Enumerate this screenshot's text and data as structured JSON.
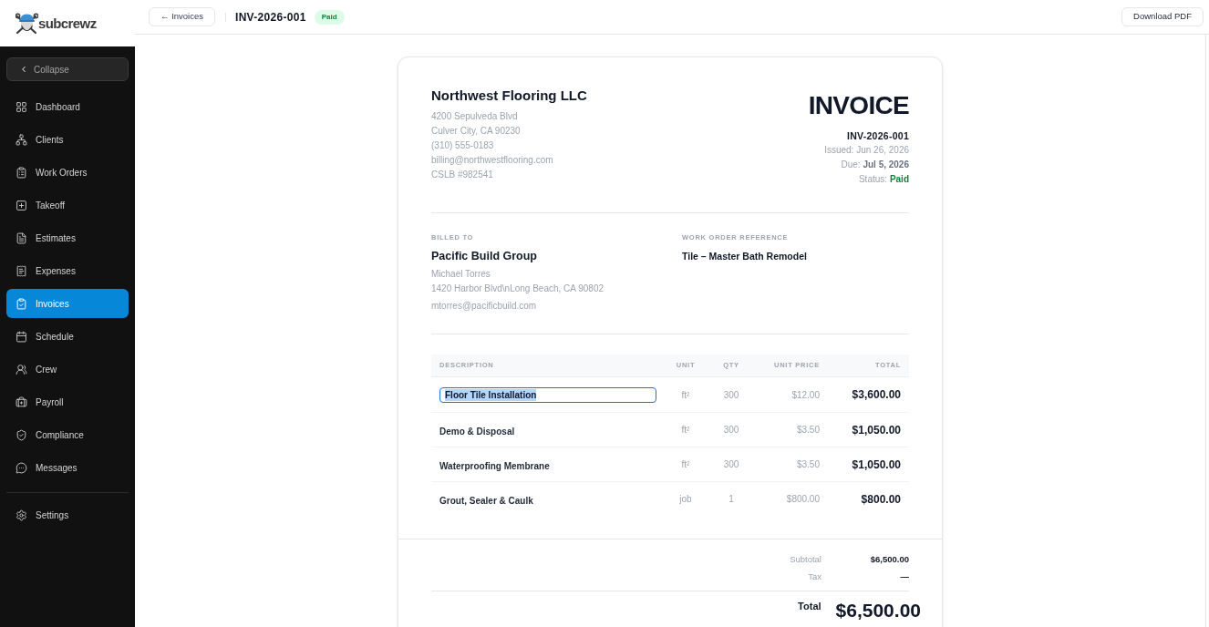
{
  "sidebar": {
    "logo_text": "subcrewz",
    "collapse_button": "Collapse",
    "nav_items": [
      {
        "label": "Dashboard",
        "selected": false
      },
      {
        "label": "Clients",
        "selected": false
      },
      {
        "label": "Work Orders",
        "selected": false
      },
      {
        "label": "Takeoff",
        "selected": false
      },
      {
        "label": "Estimates",
        "selected": false
      },
      {
        "label": "Expenses",
        "selected": false
      },
      {
        "label": "Invoices",
        "selected": true
      },
      {
        "label": "Schedule",
        "selected": false
      },
      {
        "label": "Crew",
        "selected": false
      },
      {
        "label": "Payroll",
        "selected": false
      },
      {
        "label": "Compliance",
        "selected": false
      },
      {
        "label": "Messages",
        "selected": false
      }
    ],
    "bottom_items": [
      {
        "label": "Settings",
        "selected": false
      }
    ]
  },
  "top_bar": {
    "back_button": "← Invoices",
    "title": "INV-2026-001",
    "status_badge": "Paid",
    "download_button": "Download PDF"
  },
  "invoice": {
    "company": {
      "name": "Northwest Flooring LLC",
      "lines": [
        "4200 Sepulveda Blvd",
        "Culver City, CA 90230",
        "(310) 555-0183",
        "billing@northwestflooring.com",
        "CSLB #982541"
      ]
    },
    "heading": "INVOICE",
    "number": "INV-2026-001",
    "meta": [
      {
        "label": "Issued:",
        "value": "Jun 26, 2026",
        "kind": "plain"
      },
      {
        "label": "Due:",
        "value": "Jul 5, 2026",
        "kind": "strong"
      },
      {
        "label": "Status:",
        "value": "Paid",
        "kind": "status"
      }
    ],
    "billed_to": {
      "label": "BILLED TO",
      "name": "Pacific Build Group",
      "lines": [
        "Michael Torres",
        "1420 Harbor Blvd\\nLong Beach, CA 90802"
      ],
      "email": "mtorres@pacificbuild.com"
    },
    "work_order_reference": {
      "label": "WORK ORDER REFERENCE",
      "value": "Tile – Master Bath Remodel"
    },
    "table": {
      "columns": [
        "DESCRIPTION",
        "UNIT",
        "QTY",
        "UNIT PRICE",
        "TOTAL"
      ],
      "rows": [
        {
          "description": "Floor Tile Installation",
          "unit": "ft²",
          "qty": "300",
          "unit_price": "$12.00",
          "total": "$3,600.00",
          "editing": true
        },
        {
          "description": "Demo & Disposal",
          "unit": "ft²",
          "qty": "300",
          "unit_price": "$3.50",
          "total": "$1,050.00",
          "editing": false
        },
        {
          "description": "Waterproofing Membrane",
          "unit": "ft²",
          "qty": "300",
          "unit_price": "$3.50",
          "total": "$1,050.00",
          "editing": false
        },
        {
          "description": "Grout, Sealer & Caulk",
          "unit": "job",
          "qty": "1",
          "unit_price": "$800.00",
          "total": "$800.00",
          "editing": false
        }
      ]
    },
    "totals": {
      "subtotal": {
        "label": "Subtotal",
        "value": "$6,500.00"
      },
      "tax": {
        "label": "Tax",
        "value": "—"
      },
      "total": {
        "label": "Total",
        "value": "$6,500.00"
      }
    }
  }
}
